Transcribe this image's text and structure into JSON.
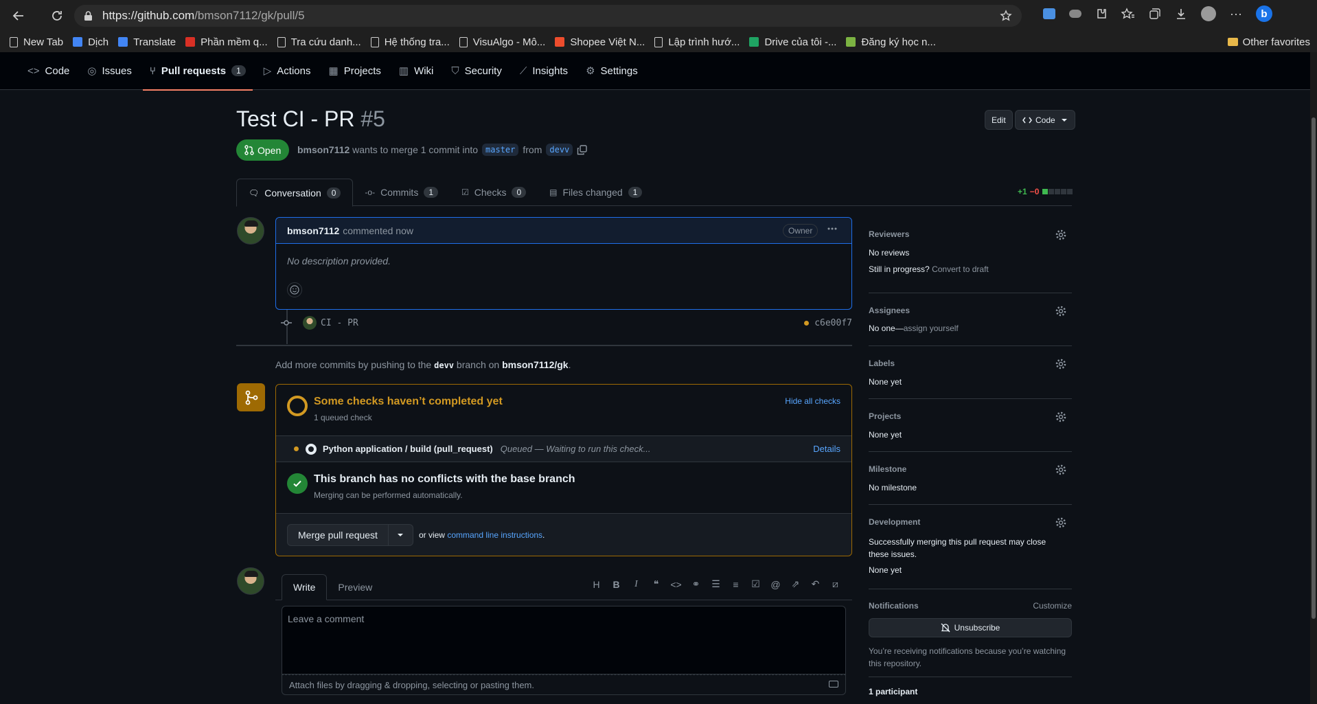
{
  "browser": {
    "url_host": "https://github.com",
    "url_path": "/bmson7112/gk/pull/5",
    "bookmarks": [
      {
        "label": "New Tab",
        "icon": "page-icon"
      },
      {
        "label": "Dịch",
        "icon": "google-translate-icon"
      },
      {
        "label": "Translate",
        "icon": "google-translate-icon"
      },
      {
        "label": "Phần mềm q...",
        "icon": "bookmark-red-icon"
      },
      {
        "label": "Tra cứu danh...",
        "icon": "page-icon"
      },
      {
        "label": "Hệ thống tra...",
        "icon": "page-icon"
      },
      {
        "label": "VisuAlgo - Mô...",
        "icon": "page-icon"
      },
      {
        "label": "Shopee Việt N...",
        "icon": "shopee-icon"
      },
      {
        "label": "Lập trình hướ...",
        "icon": "page-icon"
      },
      {
        "label": "Drive của tôi -...",
        "icon": "drive-icon"
      },
      {
        "label": "Đăng ký học n...",
        "icon": "globe-icon"
      }
    ],
    "other_favorites": "Other favorites"
  },
  "repo_nav": {
    "tabs": [
      {
        "label": "Code",
        "icon": "code-icon"
      },
      {
        "label": "Issues",
        "icon": "issue-icon"
      },
      {
        "label": "Pull requests",
        "icon": "pull-request-icon",
        "count": "1",
        "active": true
      },
      {
        "label": "Actions",
        "icon": "play-icon"
      },
      {
        "label": "Projects",
        "icon": "table-icon"
      },
      {
        "label": "Wiki",
        "icon": "book-icon"
      },
      {
        "label": "Security",
        "icon": "shield-icon"
      },
      {
        "label": "Insights",
        "icon": "graph-icon"
      },
      {
        "label": "Settings",
        "icon": "gear-icon"
      }
    ]
  },
  "pr": {
    "title": "Test CI - PR",
    "number": "#5",
    "edit_label": "Edit",
    "code_label": "Code",
    "state": "Open",
    "author": "bmson7112",
    "meta_text": "wants to merge 1 commit into",
    "base_branch": "master",
    "from_text": "from",
    "head_branch": "devv",
    "tabs": [
      {
        "label": "Conversation",
        "count": "0",
        "icon": "comment-discussion-icon"
      },
      {
        "label": "Commits",
        "count": "1",
        "icon": "commit-icon"
      },
      {
        "label": "Checks",
        "count": "0",
        "icon": "checklist-icon"
      },
      {
        "label": "Files changed",
        "count": "1",
        "icon": "file-diff-icon"
      }
    ],
    "diff_add": "+1",
    "diff_del": "−0",
    "diff_colors": {
      "add": "#3fb950",
      "del": "#f85149"
    }
  },
  "comment": {
    "author": "bmson7112",
    "action": "commented now",
    "badge": "Owner",
    "body": "No description provided."
  },
  "commit": {
    "message": "CI - PR",
    "sha": "c6e00f7"
  },
  "push_hint": {
    "prefix": "Add more commits by pushing to the",
    "branch": "devv",
    "middle": "branch on",
    "repo": "bmson7112/gk",
    "suffix": "."
  },
  "merge_box": {
    "checks_title": "Some checks haven’t completed yet",
    "checks_sub": "1 queued check",
    "hide_checks": "Hide all checks",
    "check_name": "Python application / build (pull_request)",
    "check_status": "Queued — Waiting to run this check...",
    "check_details": "Details",
    "noconf_title": "This branch has no conflicts with the base branch",
    "noconf_sub": "Merging can be performed automatically.",
    "merge_button": "Merge pull request",
    "alt_prefix": "or view",
    "alt_link": "command line instructions",
    "alt_suffix": "."
  },
  "composer": {
    "write_tab": "Write",
    "preview_tab": "Preview",
    "placeholder": "Leave a comment",
    "attach_text": "Attach files by dragging & dropping, selecting or pasting them.",
    "toolbar": [
      "heading-icon",
      "bold-icon",
      "italic-icon",
      "quote-icon",
      "code-icon",
      "link-icon",
      "unordered-list-icon",
      "ordered-list-icon",
      "task-list-icon",
      "mention-icon",
      "cross-reference-icon",
      "reply-icon",
      "slash-command-icon"
    ]
  },
  "sidebar": {
    "reviewers": {
      "title": "Reviewers",
      "value": "No reviews",
      "draft_prefix": "Still in progress?",
      "draft_link": "Convert to draft"
    },
    "assignees": {
      "title": "Assignees",
      "value": "No one—",
      "link": "assign yourself"
    },
    "labels": {
      "title": "Labels",
      "value": "None yet"
    },
    "projects": {
      "title": "Projects",
      "value": "None yet"
    },
    "milestone": {
      "title": "Milestone",
      "value": "No milestone"
    },
    "development": {
      "title": "Development",
      "desc": "Successfully merging this pull request may close these issues.",
      "value": "None yet"
    },
    "notifications": {
      "title": "Notifications",
      "customize": "Customize",
      "button": "Unsubscribe",
      "reason": "You’re receiving notifications because you’re watching this repository."
    },
    "participants": "1 participant"
  }
}
